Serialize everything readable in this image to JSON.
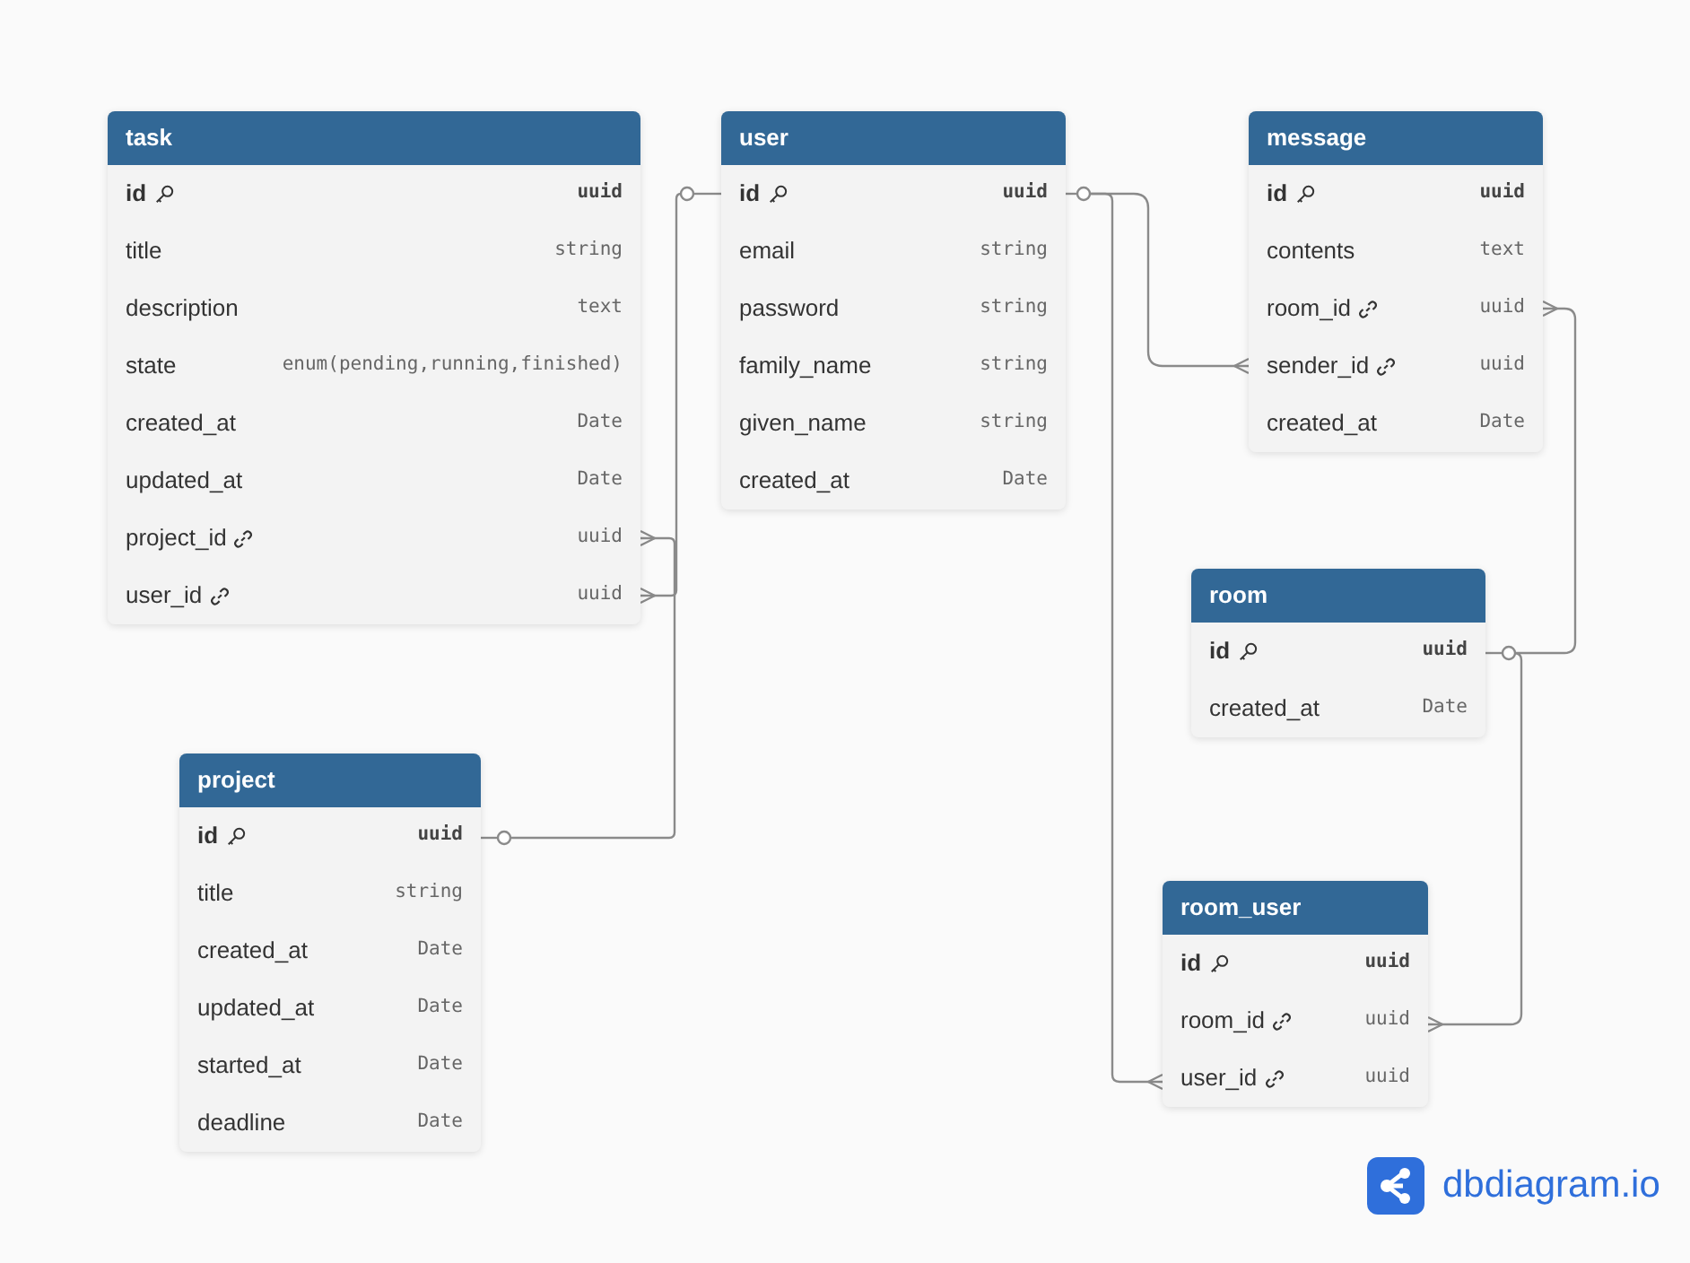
{
  "tables": [
    {
      "name": "task",
      "fields": [
        {
          "name": "id",
          "type": "uuid",
          "kind": "pk"
        },
        {
          "name": "title",
          "type": "string",
          "kind": "plain"
        },
        {
          "name": "description",
          "type": "text",
          "kind": "plain"
        },
        {
          "name": "state",
          "type": "enum(pending,running,finished)",
          "kind": "plain"
        },
        {
          "name": "created_at",
          "type": "Date",
          "kind": "plain"
        },
        {
          "name": "updated_at",
          "type": "Date",
          "kind": "plain"
        },
        {
          "name": "project_id",
          "type": "uuid",
          "kind": "fk"
        },
        {
          "name": "user_id",
          "type": "uuid",
          "kind": "fk"
        }
      ]
    },
    {
      "name": "user",
      "fields": [
        {
          "name": "id",
          "type": "uuid",
          "kind": "pk"
        },
        {
          "name": "email",
          "type": "string",
          "kind": "plain"
        },
        {
          "name": "password",
          "type": "string",
          "kind": "plain"
        },
        {
          "name": "family_name",
          "type": "string",
          "kind": "plain"
        },
        {
          "name": "given_name",
          "type": "string",
          "kind": "plain"
        },
        {
          "name": "created_at",
          "type": "Date",
          "kind": "plain"
        }
      ]
    },
    {
      "name": "message",
      "fields": [
        {
          "name": "id",
          "type": "uuid",
          "kind": "pk"
        },
        {
          "name": "contents",
          "type": "text",
          "kind": "plain"
        },
        {
          "name": "room_id",
          "type": "uuid",
          "kind": "fk"
        },
        {
          "name": "sender_id",
          "type": "uuid",
          "kind": "fk"
        },
        {
          "name": "created_at",
          "type": "Date",
          "kind": "plain"
        }
      ]
    },
    {
      "name": "room",
      "fields": [
        {
          "name": "id",
          "type": "uuid",
          "kind": "pk"
        },
        {
          "name": "created_at",
          "type": "Date",
          "kind": "plain"
        }
      ]
    },
    {
      "name": "project",
      "fields": [
        {
          "name": "id",
          "type": "uuid",
          "kind": "pk"
        },
        {
          "name": "title",
          "type": "string",
          "kind": "plain"
        },
        {
          "name": "created_at",
          "type": "Date",
          "kind": "plain"
        },
        {
          "name": "updated_at",
          "type": "Date",
          "kind": "plain"
        },
        {
          "name": "started_at",
          "type": "Date",
          "kind": "plain"
        },
        {
          "name": "deadline",
          "type": "Date",
          "kind": "plain"
        }
      ]
    },
    {
      "name": "room_user",
      "fields": [
        {
          "name": "id",
          "type": "uuid",
          "kind": "pk"
        },
        {
          "name": "room_id",
          "type": "uuid",
          "kind": "fk"
        },
        {
          "name": "user_id",
          "type": "uuid",
          "kind": "fk"
        }
      ]
    }
  ],
  "brand": {
    "name": "dbdiagram.io"
  }
}
